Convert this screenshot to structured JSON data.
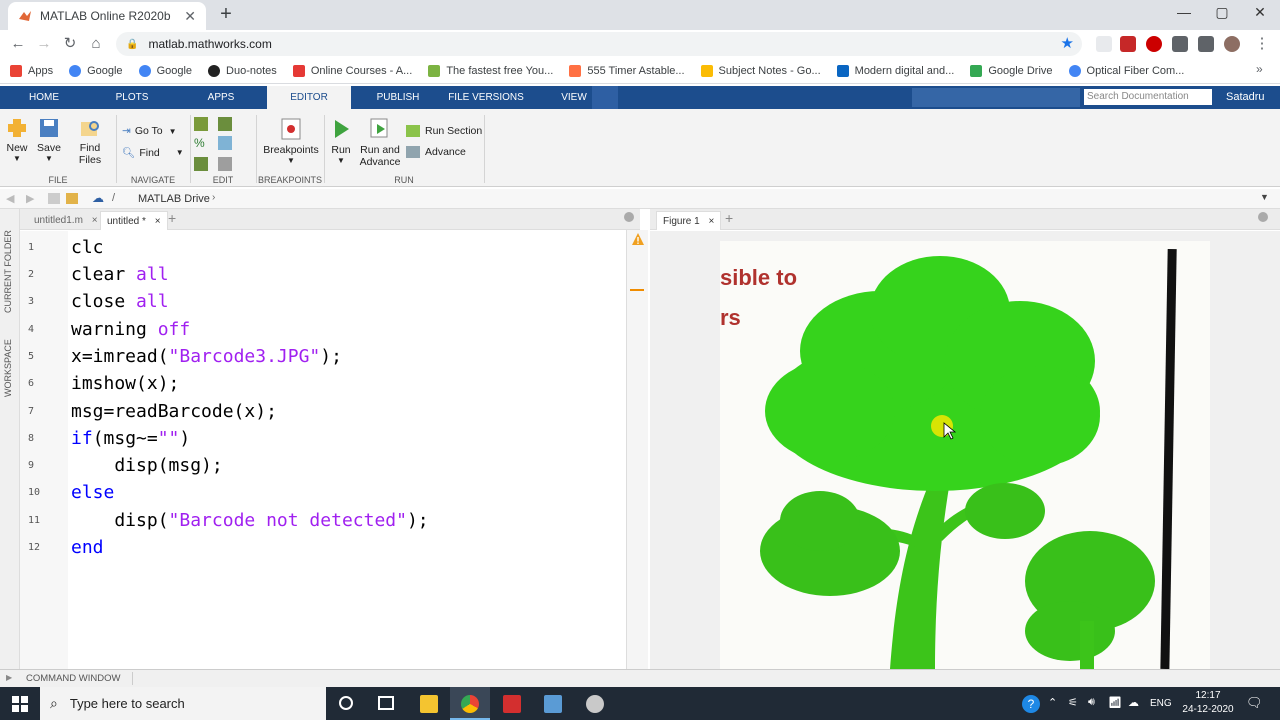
{
  "browser": {
    "tab_title": "MATLAB Online R2020b",
    "url": "matlab.mathworks.com",
    "bookmarks": [
      "Apps",
      "Google",
      "Google",
      "Duo-notes",
      "Online Courses - A...",
      "The fastest free You...",
      "555 Timer Astable...",
      "Subject Notes - Go...",
      "Modern digital and...",
      "Google Drive",
      "Optical Fiber Com..."
    ]
  },
  "matlab": {
    "tabs": [
      "HOME",
      "PLOTS",
      "APPS",
      "EDITOR",
      "PUBLISH",
      "FILE VERSIONS",
      "VIEW"
    ],
    "search_placeholder": "Search Documentation",
    "user": "Satadru",
    "ribbon": {
      "new": "New",
      "save": "Save",
      "find_files": "Find Files",
      "goto": "Go To",
      "find": "Find",
      "breakpoints": "Breakpoints",
      "run": "Run",
      "run_advance": "Run and Advance",
      "run_section": "Run Section",
      "advance": "Advance",
      "groups": [
        "FILE",
        "NAVIGATE",
        "EDIT",
        "BREAKPOINTS",
        "RUN"
      ]
    },
    "path": "MATLAB Drive",
    "side_labels": [
      "CURRENT FOLDER",
      "WORKSPACE"
    ],
    "editor_tabs": [
      "untitled1.m",
      "untitled *"
    ],
    "figure_tab": "Figure 1",
    "photo_text": [
      "sible to",
      "rs"
    ],
    "command_window": "COMMAND WINDOW",
    "code_lines": [
      [
        "clc"
      ],
      [
        "clear ",
        "all"
      ],
      [
        "close ",
        "all"
      ],
      [
        "warning ",
        "off"
      ],
      [
        "x=imread(",
        "\"Barcode3.JPG\"",
        ");"
      ],
      [
        "imshow(x);"
      ],
      [
        "msg=readBarcode(x);"
      ],
      [
        "if",
        "(msg~=",
        "\"\"",
        ")"
      ],
      [
        "    disp(msg);"
      ],
      [
        "else"
      ],
      [
        "    disp(",
        "\"Barcode not detected\"",
        ");"
      ],
      [
        "end"
      ]
    ]
  },
  "taskbar": {
    "search": "Type here to search",
    "lang": "ENG",
    "time": "12:17",
    "date": "24-12-2020"
  }
}
